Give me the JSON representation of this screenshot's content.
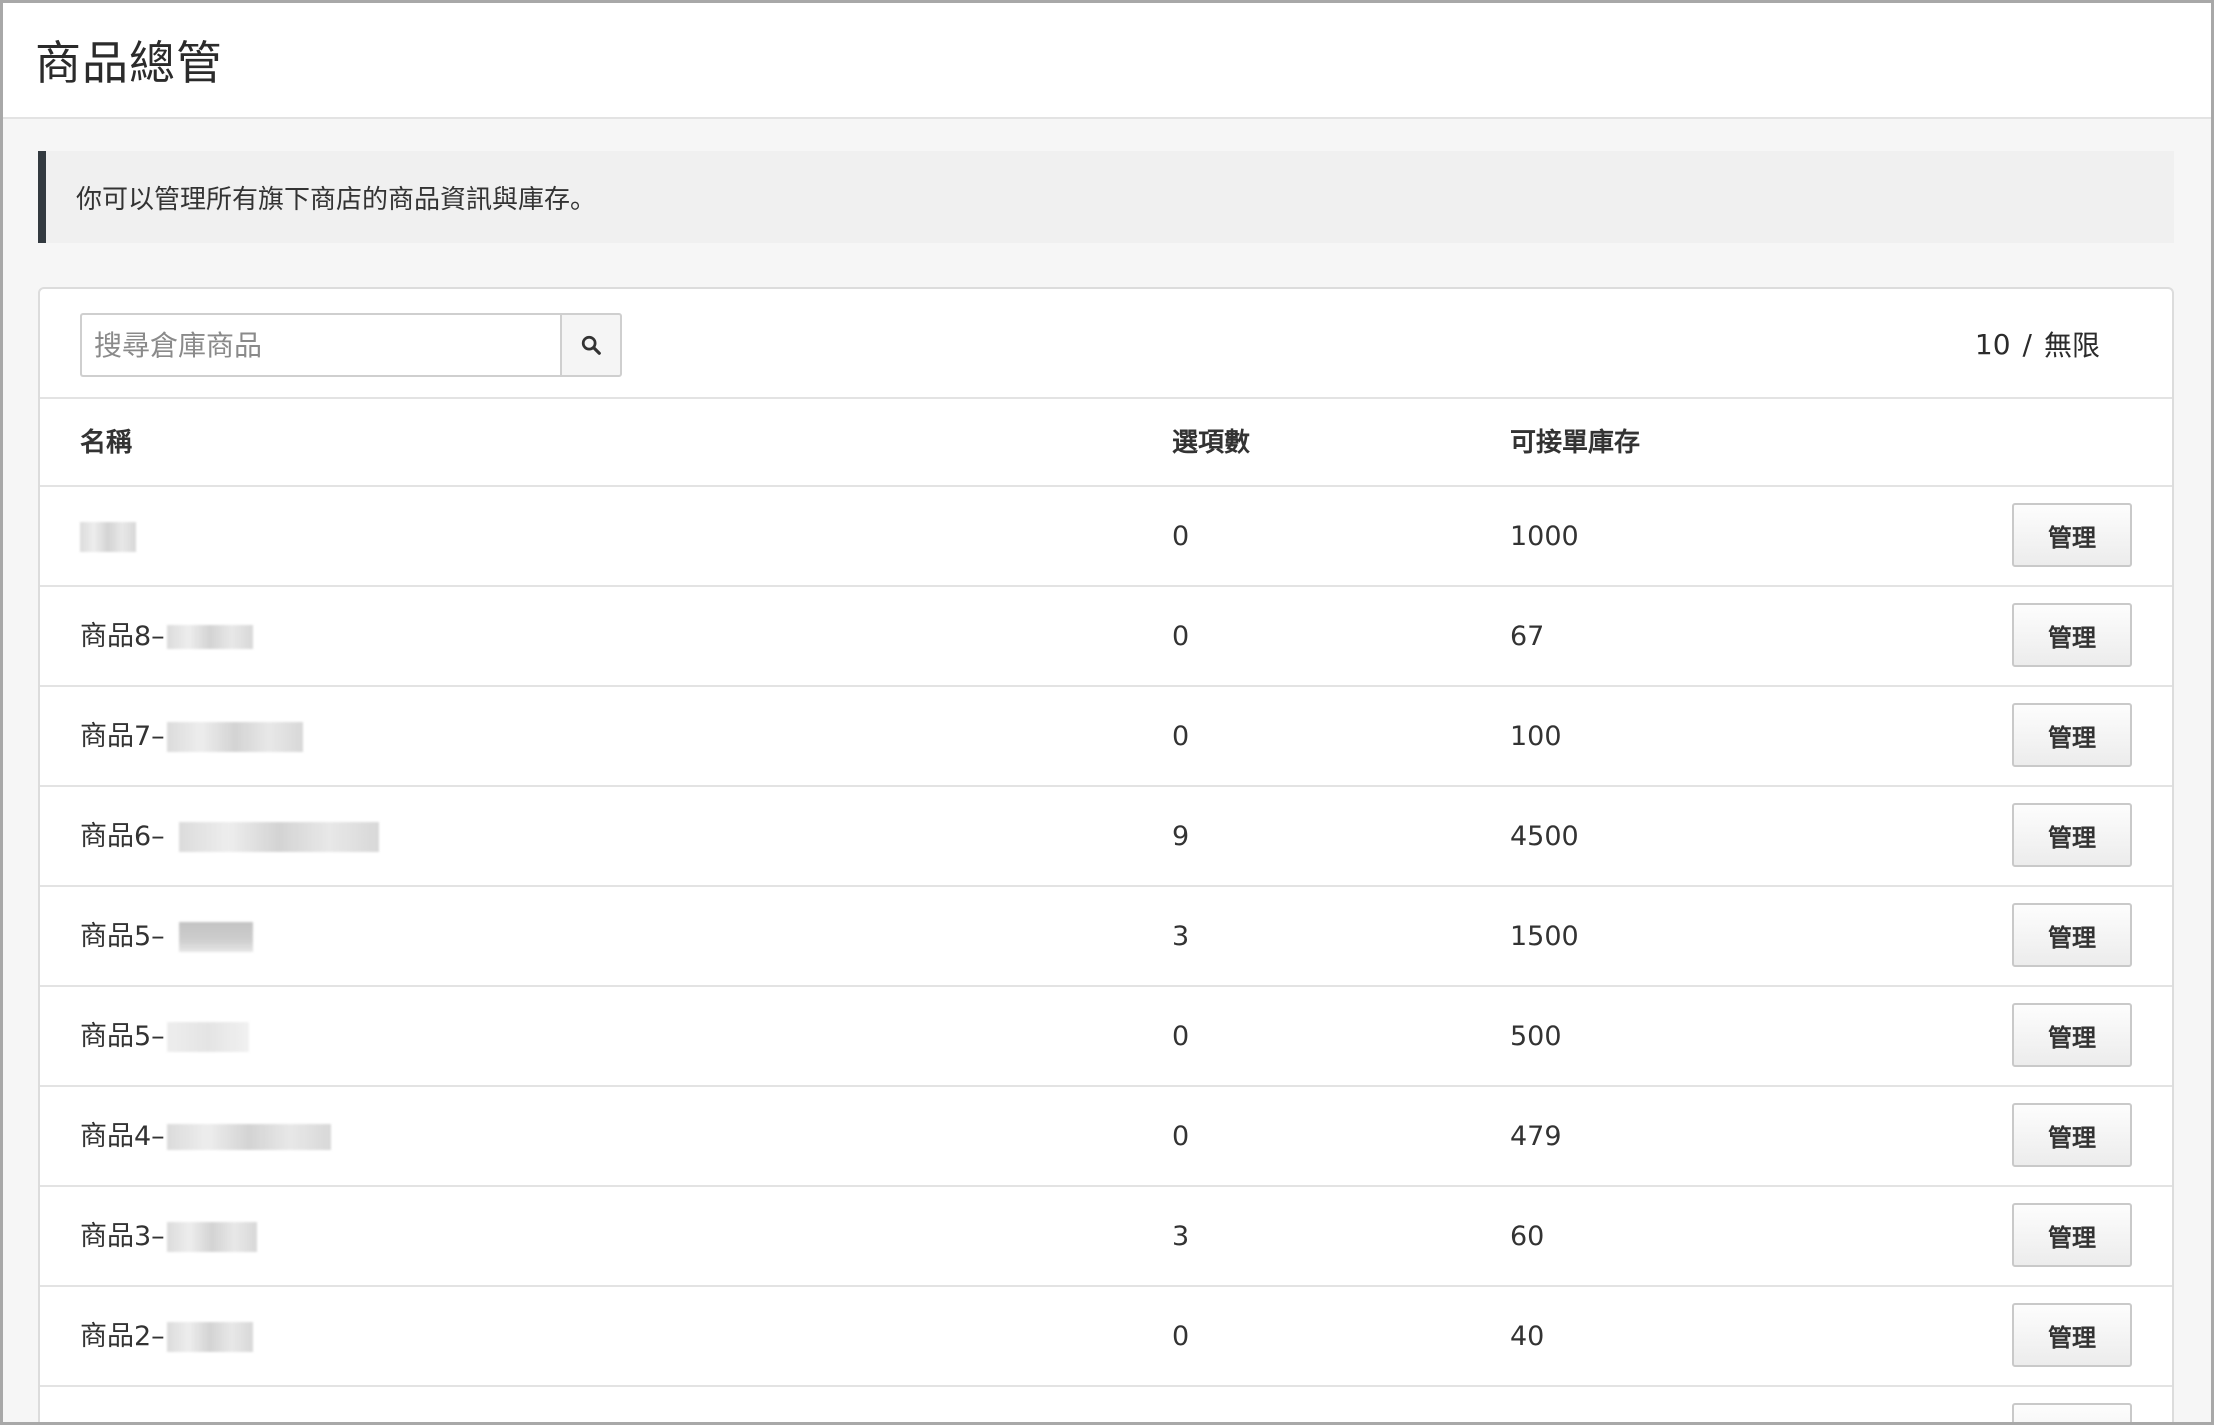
{
  "page": {
    "title": "商品總管"
  },
  "notice": {
    "text": "你可以管理所有旗下商店的商品資訊與庫存。"
  },
  "search": {
    "placeholder": "搜尋倉庫商品",
    "value": ""
  },
  "quota": {
    "used": "10",
    "separator": "/",
    "limit": "無限"
  },
  "table": {
    "headers": {
      "name": "名稱",
      "options": "選項數",
      "stock": "可接單庫存"
    },
    "action_label": "管理",
    "rows": [
      {
        "name": "",
        "options": "0",
        "stock": "1000"
      },
      {
        "name": "商品8–",
        "options": "0",
        "stock": "67"
      },
      {
        "name": "商品7–",
        "options": "0",
        "stock": "100"
      },
      {
        "name": "商品6–",
        "options": "9",
        "stock": "4500"
      },
      {
        "name": "商品5–",
        "options": "3",
        "stock": "1500"
      },
      {
        "name": "商品5–",
        "options": "0",
        "stock": "500"
      },
      {
        "name": "商品4–",
        "options": "0",
        "stock": "479"
      },
      {
        "name": "商品3–",
        "options": "3",
        "stock": "60"
      },
      {
        "name": "商品2–",
        "options": "0",
        "stock": "40"
      }
    ]
  }
}
